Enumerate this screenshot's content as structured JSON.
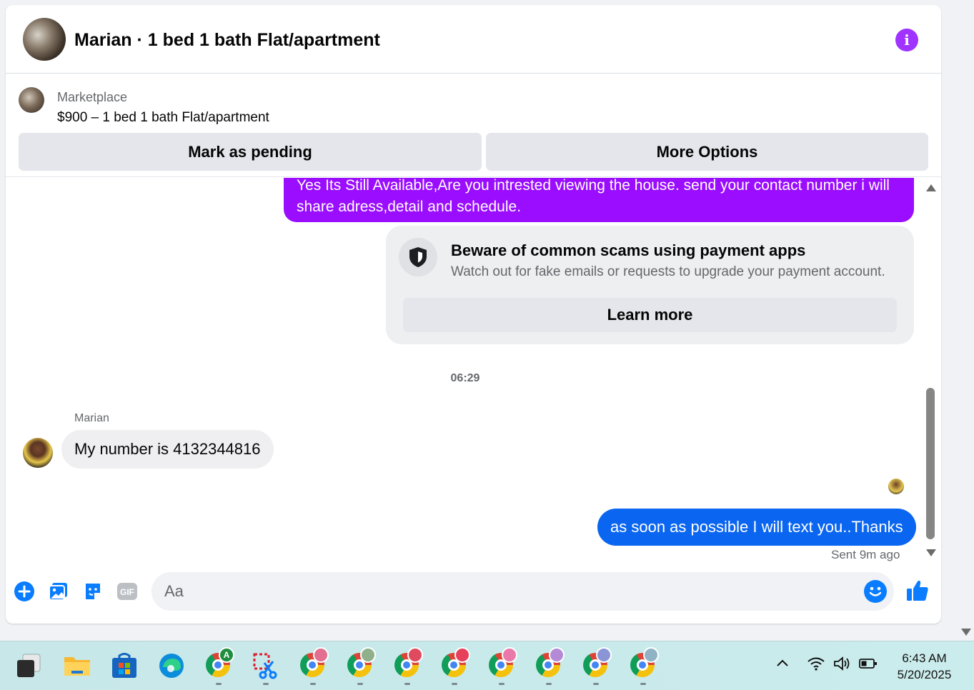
{
  "header": {
    "title": "Marian · 1 bed 1 bath Flat/apartment"
  },
  "listing": {
    "source": "Marketplace",
    "price_line": "$900 – 1 bed 1 bath Flat/apartment",
    "mark_pending_label": "Mark as pending",
    "more_options_label": "More Options"
  },
  "thread": {
    "outgoing_purple_text": "Yes Its Still Available,Are you intrested viewing the house. send your contact number i will share adress,detail and schedule.",
    "scam_notice": {
      "heading": "Beware of common scams using payment apps",
      "subtext": "Watch out for fake emails or requests to upgrade your payment account.",
      "learn_more_label": "Learn more"
    },
    "timestamp": "06:29",
    "incoming": {
      "sender": "Marian",
      "text": "My number is 4132344816"
    },
    "outgoing_blue_text": "as soon as possible I will text you..Thanks",
    "sent_status": "Sent 9m ago"
  },
  "composer": {
    "placeholder": "Aa"
  },
  "colors": {
    "accent_purple": "#9a0dfe",
    "accent_blue": "#0a66f0",
    "info_icon": "#a033ff",
    "messenger_blue": "#0a7cff"
  },
  "taskbar": {
    "apps": [
      "task-view",
      "file-explorer",
      "microsoft-store",
      "edge",
      "chrome-profile-A",
      "snipping-tool",
      "chrome",
      "chrome",
      "chrome",
      "chrome",
      "chrome",
      "chrome",
      "chrome",
      "chrome"
    ],
    "chrome_badge_letter": "A",
    "time": "6:43 AM",
    "date": "5/20/2025"
  }
}
